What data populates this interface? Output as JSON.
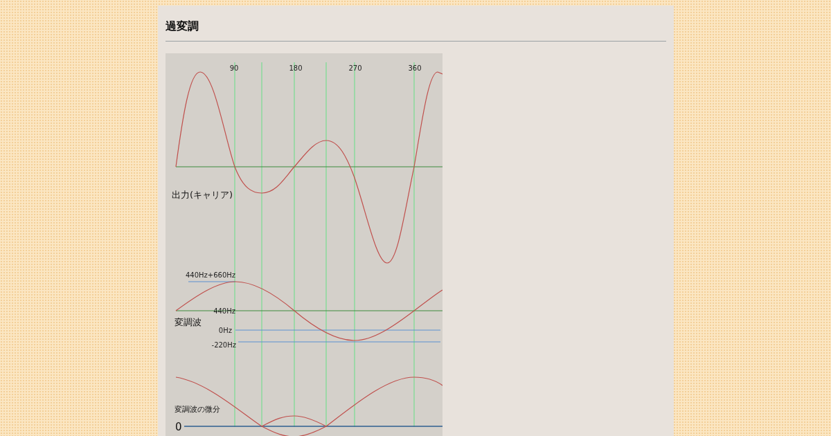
{
  "title": "過変調",
  "figure": {
    "tick_labels": [
      "90",
      "180",
      "270",
      "360"
    ],
    "carrier_label": "出力(キャリア)",
    "modulating_wave_label": "変調波",
    "frequency_labels": [
      "440Hz+660Hz",
      "440Hz",
      "0Hz",
      "-220Hz"
    ],
    "derivative_label": "変調波の微分",
    "zero_label": "0"
  }
}
